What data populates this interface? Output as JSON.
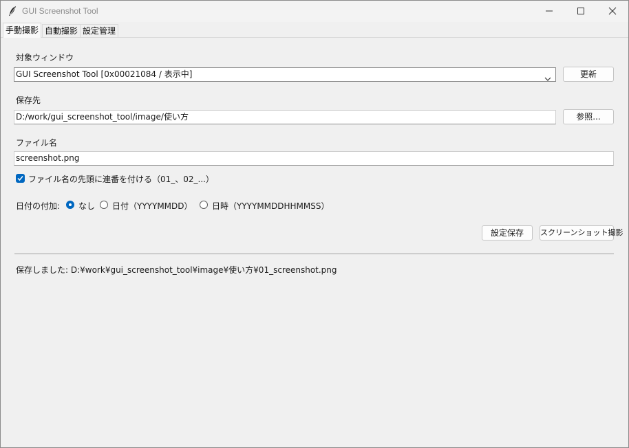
{
  "window": {
    "title": "GUI Screenshot Tool",
    "app_icon": "feather-icon"
  },
  "tabs": [
    {
      "label": "手動撮影",
      "active": true
    },
    {
      "label": "自動撮影",
      "active": false
    },
    {
      "label": "設定管理",
      "active": false
    }
  ],
  "target": {
    "label": "対象ウィンドウ",
    "selected": "GUI Screenshot Tool  [0x00021084 / 表示中]",
    "refresh_button": "更新"
  },
  "save_dir": {
    "label": "保存先",
    "value": "D:/work/gui_screenshot_tool/image/使い方",
    "browse_button": "参照..."
  },
  "filename": {
    "label": "ファイル名",
    "value": "screenshot.png"
  },
  "sequence": {
    "label": "ファイル名の先頭に連番を付ける（01_、02_...）",
    "checked": true
  },
  "date_option": {
    "label": "日付の付加:",
    "options": [
      {
        "label": "なし",
        "selected": true
      },
      {
        "label": "日付（YYYYMMDD）",
        "selected": false
      },
      {
        "label": "日時（YYYYMMDDHHMMSS）",
        "selected": false
      }
    ]
  },
  "actions": {
    "save_settings": "設定保存",
    "capture": "スクリーンショット撮影"
  },
  "status": {
    "message": "保存しました: D:¥work¥gui_screenshot_tool¥image¥使い方¥01_screenshot.png"
  },
  "colors": {
    "accent": "#0067c0",
    "background": "#f0f0f0",
    "titlebar": "#f3f3f3"
  }
}
